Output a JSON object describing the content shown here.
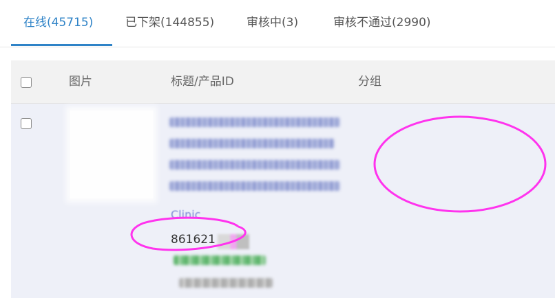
{
  "tabs": [
    {
      "label": "在线(45715)",
      "active": true
    },
    {
      "label": "已下架(144855)",
      "active": false
    },
    {
      "label": "审核中(3)",
      "active": false
    },
    {
      "label": "审核不通过(2990)",
      "active": false
    }
  ],
  "table": {
    "headers": {
      "image": "图片",
      "title_product_id": "标题/产品ID",
      "group": "分组"
    },
    "rows": [
      {
        "title_tail": "Clinic",
        "product_id_visible": "861621"
      }
    ]
  },
  "colors": {
    "accent": "#2f83c7",
    "annotation": "#ff33ee"
  }
}
